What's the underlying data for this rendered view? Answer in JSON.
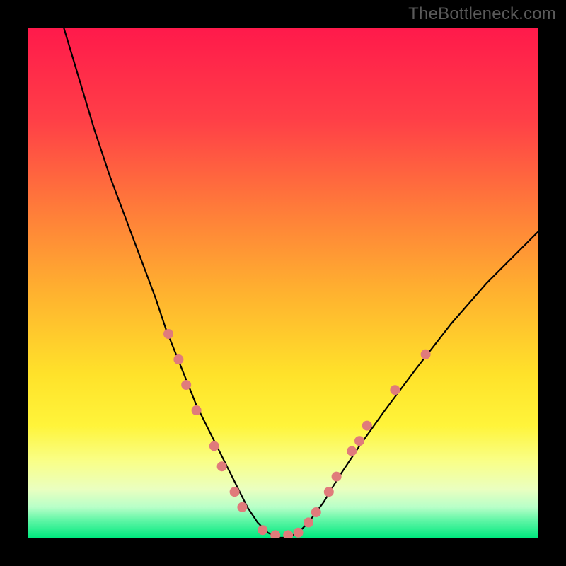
{
  "watermark": "TheBottleneck.com",
  "chart_data": {
    "type": "line",
    "title": "",
    "xlabel": "",
    "ylabel": "",
    "xlim": [
      0,
      100
    ],
    "ylim": [
      0,
      100
    ],
    "grid": false,
    "legend": false,
    "background_gradient_stops": [
      {
        "offset": 0.0,
        "color": "#ff1a4b"
      },
      {
        "offset": 0.18,
        "color": "#ff3f47"
      },
      {
        "offset": 0.35,
        "color": "#ff7a3a"
      },
      {
        "offset": 0.52,
        "color": "#ffb22f"
      },
      {
        "offset": 0.68,
        "color": "#ffe22a"
      },
      {
        "offset": 0.78,
        "color": "#fff43a"
      },
      {
        "offset": 0.85,
        "color": "#f9ff88"
      },
      {
        "offset": 0.905,
        "color": "#eaffc0"
      },
      {
        "offset": 0.94,
        "color": "#b8ffc8"
      },
      {
        "offset": 0.965,
        "color": "#63f6a7"
      },
      {
        "offset": 1.0,
        "color": "#00e97f"
      }
    ],
    "series": [
      {
        "name": "bottleneck-curve",
        "color": "#000000",
        "stroke_width": 2.2,
        "x": [
          7,
          10,
          13,
          16,
          19,
          22,
          25,
          27,
          29,
          31,
          33,
          35,
          37,
          39,
          41,
          43,
          45,
          47,
          49,
          51,
          53,
          55,
          58,
          61,
          65,
          70,
          76,
          83,
          90,
          97,
          100
        ],
        "y": [
          100,
          90,
          80,
          71,
          63,
          55,
          47,
          41,
          36,
          31,
          26,
          22,
          18,
          14,
          10,
          6,
          3,
          1,
          0,
          0,
          1,
          3,
          7,
          12,
          18,
          25,
          33,
          42,
          50,
          57,
          60
        ]
      }
    ],
    "scatter": {
      "name": "highlight-dots",
      "color": "#e07b7b",
      "radius": 7,
      "points": [
        {
          "x": 27.5,
          "y": 40
        },
        {
          "x": 29.5,
          "y": 35
        },
        {
          "x": 31.0,
          "y": 30
        },
        {
          "x": 33.0,
          "y": 25
        },
        {
          "x": 36.5,
          "y": 18
        },
        {
          "x": 38.0,
          "y": 14
        },
        {
          "x": 40.5,
          "y": 9
        },
        {
          "x": 42.0,
          "y": 6
        },
        {
          "x": 46.0,
          "y": 1.5
        },
        {
          "x": 48.5,
          "y": 0.5
        },
        {
          "x": 51.0,
          "y": 0.5
        },
        {
          "x": 53.0,
          "y": 1
        },
        {
          "x": 55.0,
          "y": 3
        },
        {
          "x": 56.5,
          "y": 5
        },
        {
          "x": 59.0,
          "y": 9
        },
        {
          "x": 60.5,
          "y": 12
        },
        {
          "x": 63.5,
          "y": 17
        },
        {
          "x": 65.0,
          "y": 19
        },
        {
          "x": 66.5,
          "y": 22
        },
        {
          "x": 72.0,
          "y": 29
        },
        {
          "x": 78.0,
          "y": 36
        }
      ]
    }
  }
}
